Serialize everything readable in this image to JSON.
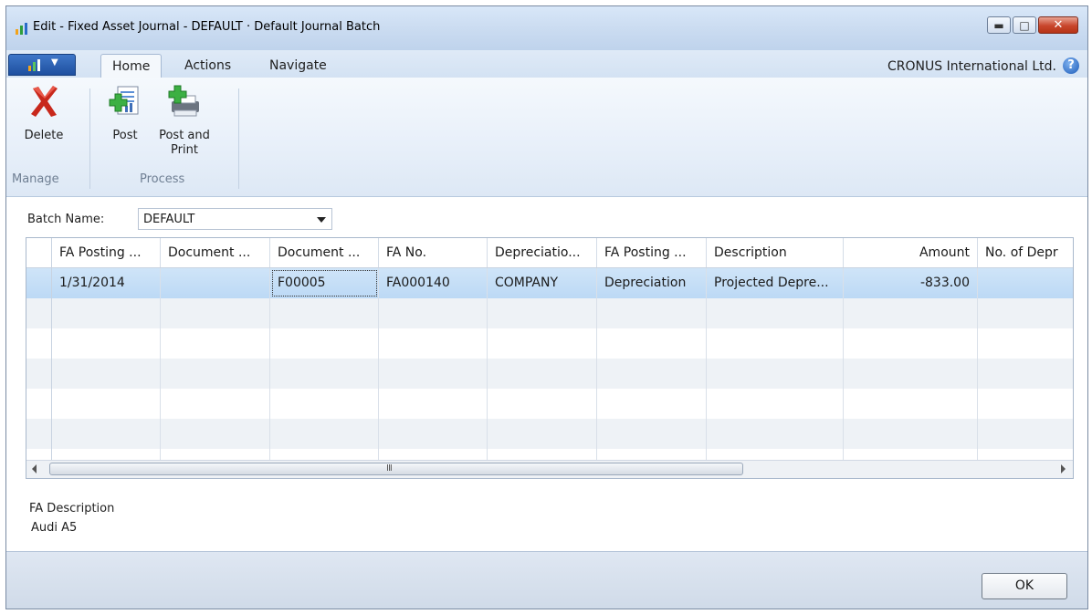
{
  "window": {
    "title": "Edit - Fixed Asset Journal - DEFAULT · Default Journal Batch",
    "minimize_icon": "minimize-icon",
    "maximize_icon": "maximize-icon",
    "close_icon": "close-icon"
  },
  "tabs": [
    {
      "label": "Home",
      "active": true
    },
    {
      "label": "Actions",
      "active": false
    },
    {
      "label": "Navigate",
      "active": false
    }
  ],
  "company": "CRONUS International Ltd.",
  "ribbon": {
    "groups": [
      {
        "label": "Manage",
        "buttons": [
          {
            "label": "Delete",
            "icon": "delete-icon"
          }
        ]
      },
      {
        "label": "Process",
        "buttons": [
          {
            "label": "Post",
            "icon": "post-icon"
          },
          {
            "label": "Post and Print",
            "icon": "post-and-print-icon"
          }
        ]
      }
    ]
  },
  "batch": {
    "label": "Batch Name:",
    "value": "DEFAULT"
  },
  "grid": {
    "columns": [
      "FA Posting ...",
      "Document ...",
      "Document ...",
      "FA No.",
      "Depreciatio...",
      "FA Posting ...",
      "Description",
      "Amount",
      "No. of Depr"
    ],
    "rows": [
      [
        "1/31/2014",
        "",
        "F00005",
        "FA000140",
        "COMPANY",
        "Depreciation",
        "Projected Depre...",
        "-833.00",
        ""
      ]
    ],
    "scroll_grip": "III"
  },
  "fa_description": {
    "label": "FA Description",
    "value": "Audi A5"
  },
  "footer": {
    "ok_label": "OK"
  },
  "colors": {
    "selection": "#bcd9f5",
    "close_button": "#c8462c",
    "app_button": "#1e4f9f"
  }
}
